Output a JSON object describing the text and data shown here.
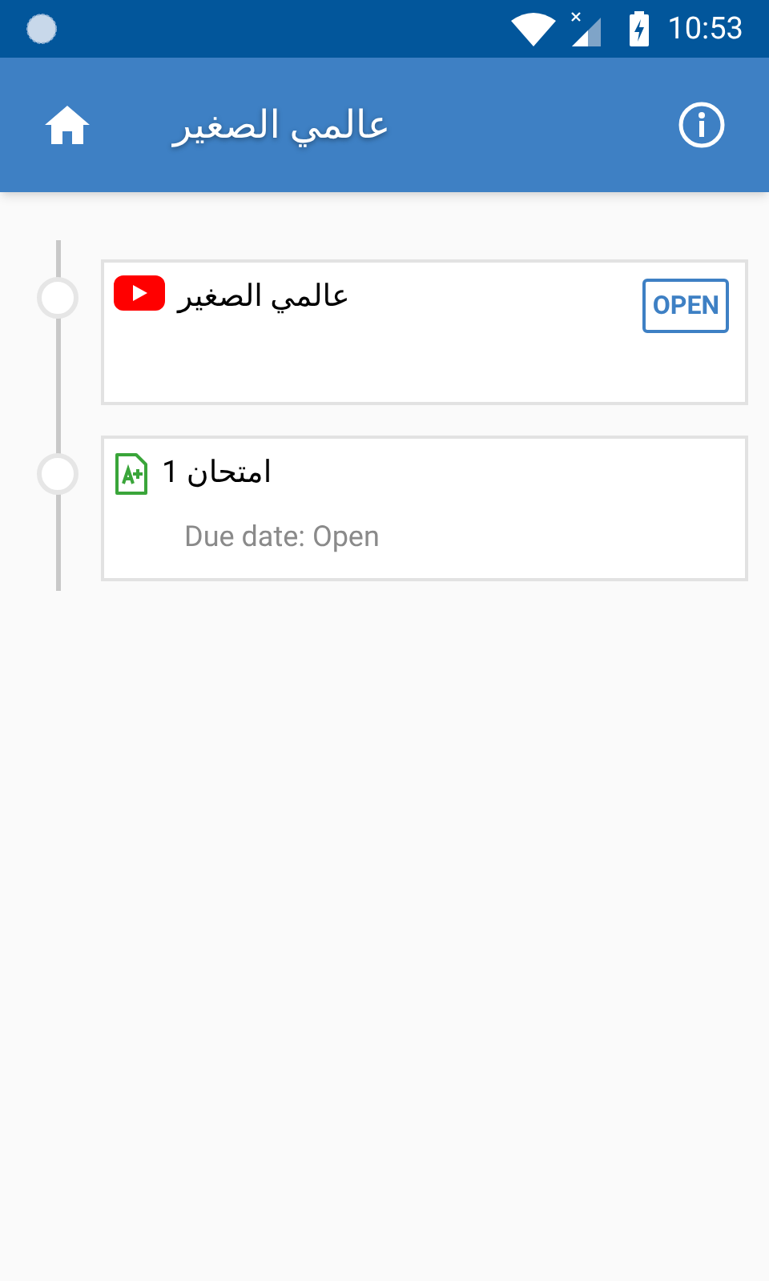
{
  "status_bar": {
    "time": "10:53"
  },
  "app_bar": {
    "title": "عالمي الصغير"
  },
  "items": [
    {
      "kind": "video",
      "title": "عالمي الصغير",
      "button": "OPEN"
    },
    {
      "kind": "assignment",
      "title": "امتحان 1",
      "due": "Due date: Open"
    }
  ]
}
